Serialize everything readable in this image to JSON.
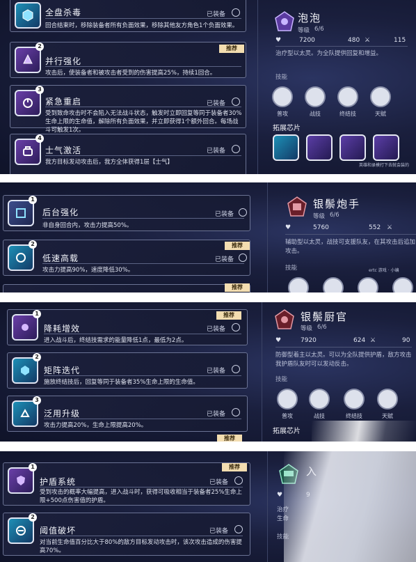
{
  "common": {
    "equipped": "已装备",
    "recommend": "推荐",
    "level_label": "等级",
    "skills_label": "技能",
    "ext_chips_label": "拓展芯片"
  },
  "skill_names": [
    "普攻",
    "战技",
    "终结技",
    "天赋"
  ],
  "panel1": {
    "chips": [
      {
        "num": "",
        "title": "全盘杀毒",
        "desc": "回合结束时，移除装备者所有负面效果，移除其他友方角色1个负面效果。",
        "recommended": false
      },
      {
        "num": "2",
        "title": "并行强化",
        "desc": "攻击后，使装备者和被攻击者受到的伤害提高25%，持续1回合。",
        "recommended": true
      },
      {
        "num": "3",
        "title": "紧急重启",
        "desc": "受到致命攻击时不会陷入无法战斗状态，触发时立即回复等同于装备者30%生命上限的生命值，解除所有负面效果，并立即获得1个额外回合。每场战斗可触发1次。",
        "recommended": false
      },
      {
        "num": "4",
        "title": "士气激活",
        "desc": "我方目标发动攻击后，我方全体获得1层【士气】",
        "recommended": false
      }
    ],
    "right": {
      "name": "泡泡",
      "level": "6/6",
      "hp": "7200",
      "atk": "480",
      "def": "115",
      "desc": "治疗型以太灵。为全队提供回复和增益。",
      "note": "英雄和录模打下去就会装的"
    }
  },
  "panel2": {
    "chips": [
      {
        "num": "1",
        "title": "后台强化",
        "desc": "非自身回合内，攻击力提高50%。",
        "recommended": false
      },
      {
        "num": "2",
        "title": "低速高载",
        "desc": "攻击力提高90%，速度降低30%。",
        "recommended": true
      }
    ],
    "right": {
      "name": "银鬃炮手",
      "level": "6/6",
      "hp": "5760",
      "atk": "552",
      "desc": "辅助型以太灵，战技可支援队友，在其攻击后追加攻击。",
      "watermark": "ertc 游戏 · 小编"
    }
  },
  "panel3": {
    "chips": [
      {
        "num": "1",
        "title": "降耗增效",
        "desc": "进入战斗后，终结技需求的能量降低1点，最低为2点。",
        "recommended": true
      },
      {
        "num": "2",
        "title": "矩阵迭代",
        "desc": "施放终结技后，回复等同于装备者35%生命上限的生命值。",
        "recommended": false
      },
      {
        "num": "3",
        "title": "泛用升级",
        "desc": "攻击力提高20%，生命上限提高20%。",
        "recommended": false
      }
    ],
    "right": {
      "name": "银鬃厨官",
      "level": "6/6",
      "hp": "7920",
      "atk": "624",
      "def": "90",
      "desc": "防御型着主以太灵。可以为全队提供护盾，敌方攻击我护盾队友时可以发动反击。"
    }
  },
  "panel4": {
    "chips": [
      {
        "num": "1",
        "title": "护盾系统",
        "desc": "受到攻击的概率大幅提高，进入战斗时，获得可吸收相当于装备者25%生命上限+500点伤害值的护盾。",
        "recommended": true
      },
      {
        "num": "2",
        "title": "阈值破坏",
        "desc": "对当前生命值百分比大于80%的敌方目标发动攻击时，该次攻击造成的伤害提高70%。",
        "recommended": false
      }
    ],
    "right": {
      "name": "入",
      "hp": "9",
      "desc": "治疗 生命"
    }
  },
  "colors": {
    "recommend_bg": "#f3ddb0",
    "panel_bg": "#1a1f3d",
    "border": "#6b7394"
  }
}
